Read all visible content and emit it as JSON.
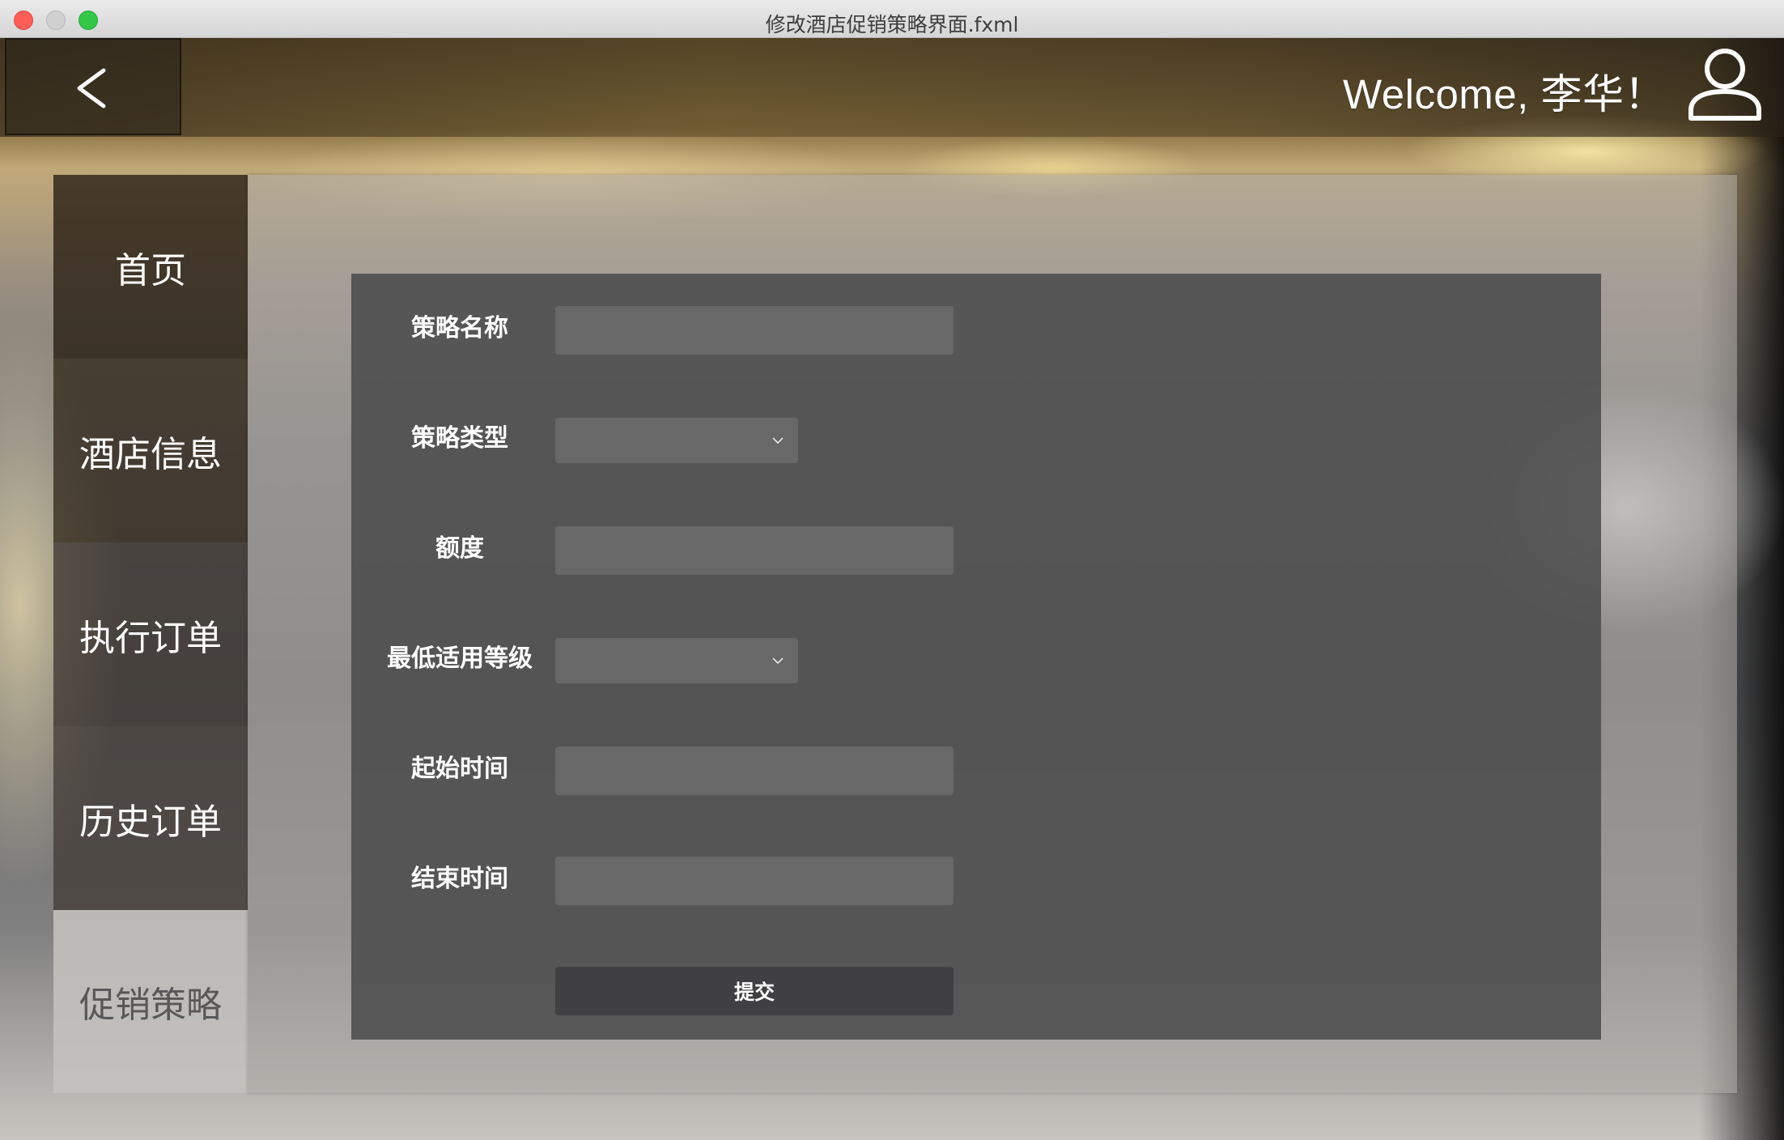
{
  "window": {
    "title": "修改酒店促销策略界面.fxml"
  },
  "header": {
    "back_symbol": "<",
    "welcome_text": "Welcome, 李华！",
    "avatar_icon": "user-icon"
  },
  "sidebar": {
    "items": [
      {
        "label": "首页",
        "active": false
      },
      {
        "label": "酒店信息",
        "active": false
      },
      {
        "label": "执行订单",
        "active": false
      },
      {
        "label": "历史订单",
        "active": false
      },
      {
        "label": "促销策略",
        "active": true
      }
    ]
  },
  "form": {
    "fields": [
      {
        "label": "策略名称",
        "type": "text",
        "value": ""
      },
      {
        "label": "策略类型",
        "type": "select",
        "value": ""
      },
      {
        "label": "额度",
        "type": "text",
        "value": ""
      },
      {
        "label": "最低适用等级",
        "type": "select",
        "value": ""
      },
      {
        "label": "起始时间",
        "type": "text",
        "value": ""
      },
      {
        "label": "结束时间",
        "type": "text",
        "value": ""
      }
    ],
    "submit_label": "提交"
  },
  "colors": {
    "close": "#fc5f57",
    "minimize": "#d1d0d1",
    "maximize": "#35c748",
    "active_menu": "#c4c2be",
    "form_card": "#4a4a4c"
  }
}
